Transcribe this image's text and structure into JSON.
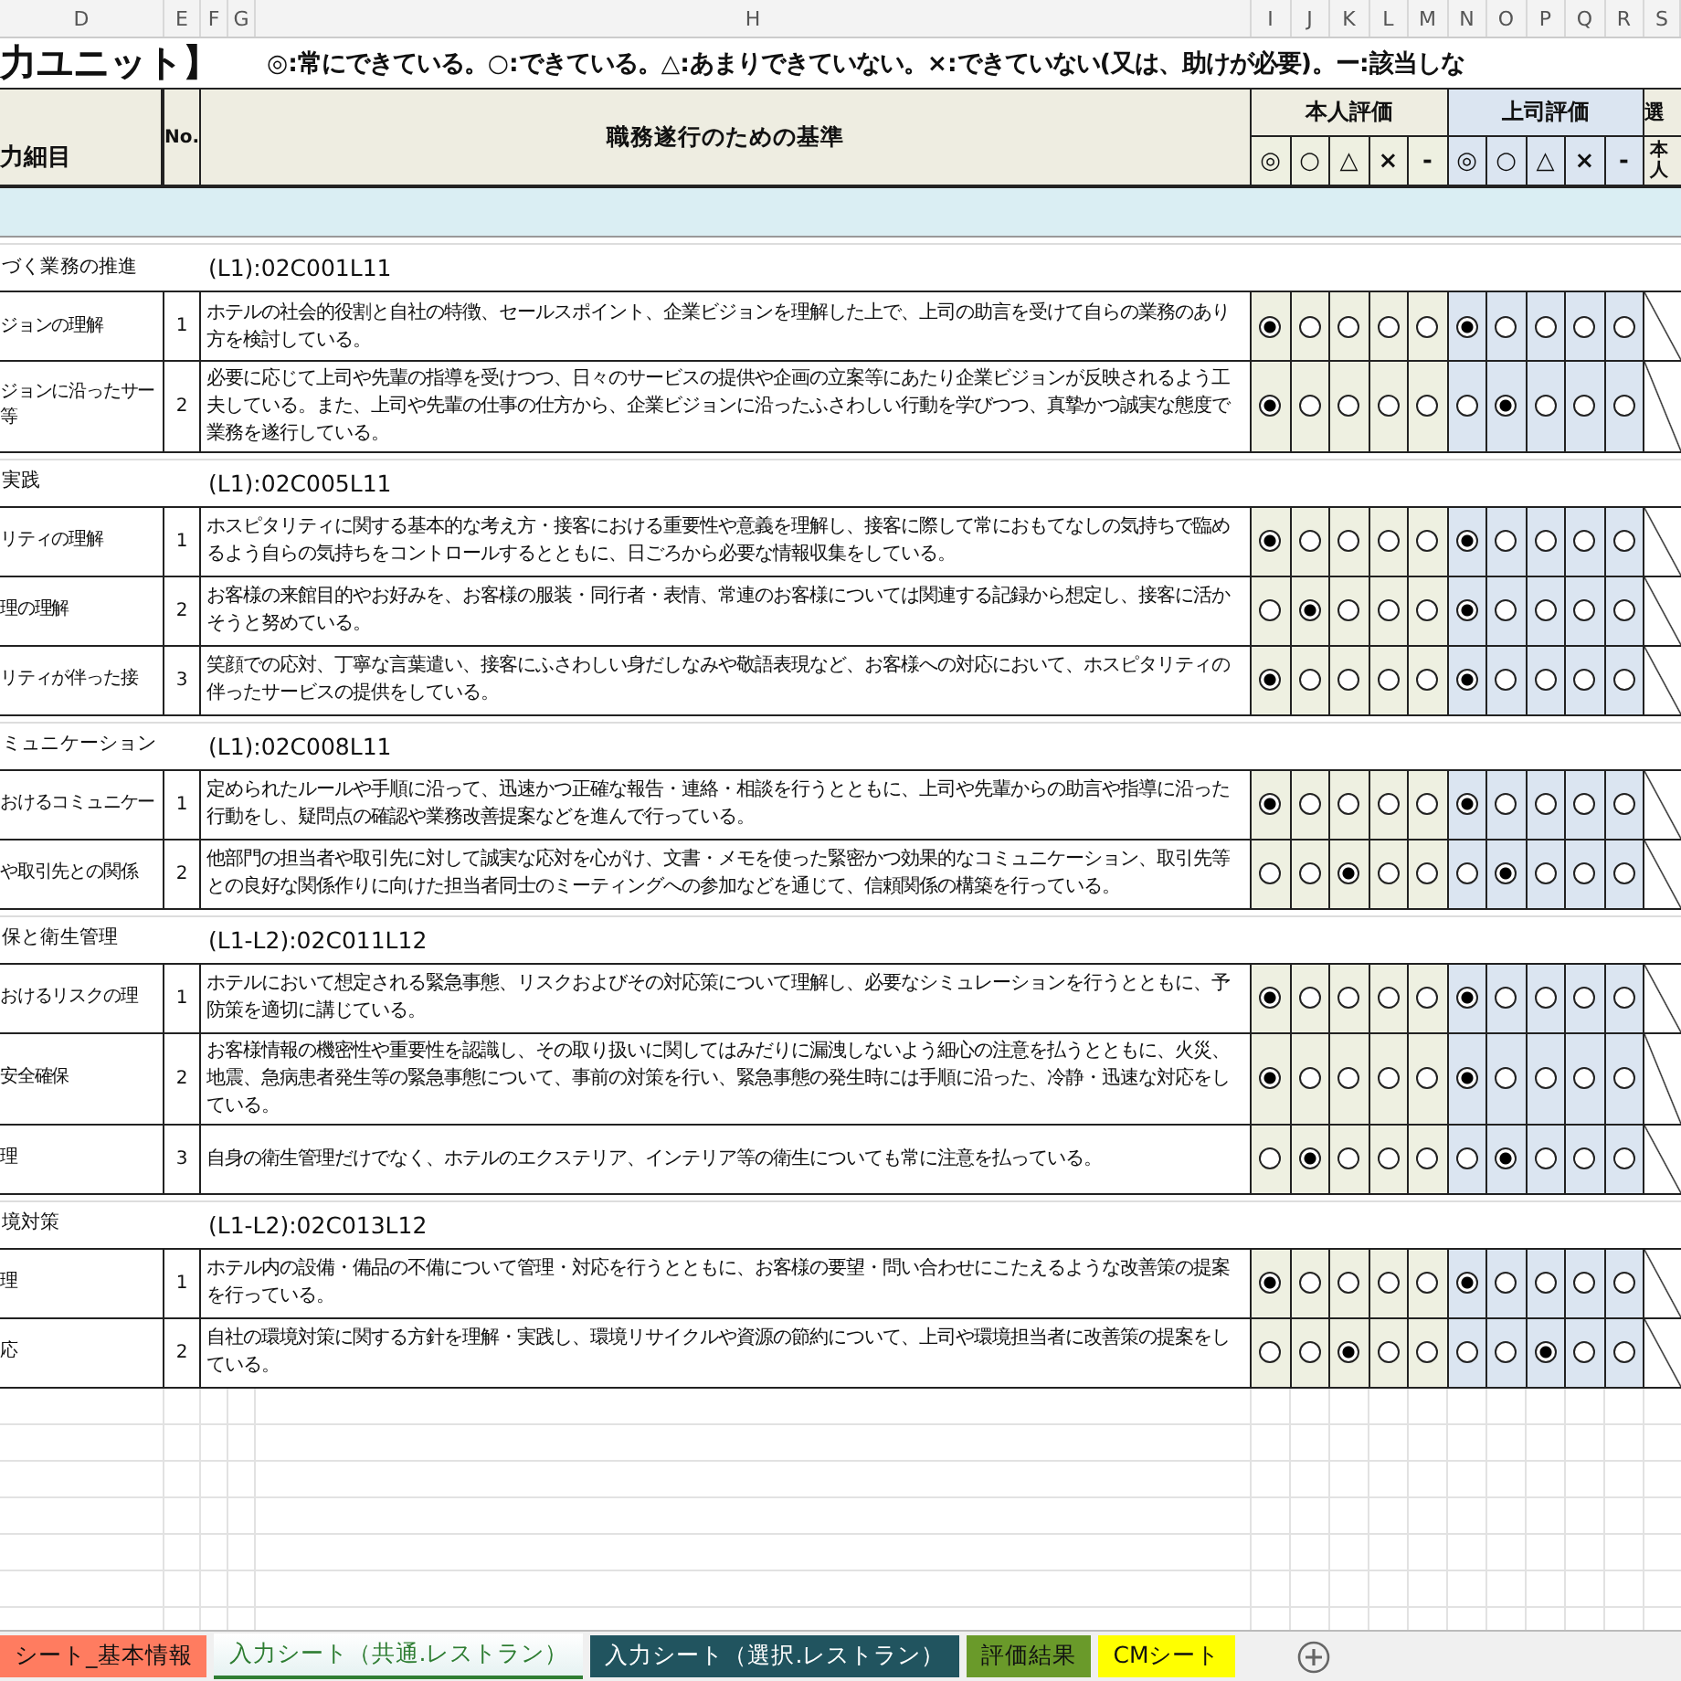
{
  "column_headers": [
    "D",
    "E",
    "F",
    "G",
    "H",
    "I",
    "J",
    "K",
    "L",
    "M",
    "N",
    "O",
    "P",
    "Q",
    "R",
    "S"
  ],
  "title": "力ユニット】",
  "legend": "◎:常にできている。○:できている。△:あまりできていない。×:できていない(又は、助けが必要)。ー:該当しな",
  "table_header": {
    "category": "力細目",
    "number": "No.",
    "criteria": "職務遂行のための基準",
    "self_group": "本人評価",
    "boss_group": "上司評価",
    "select_group": "選",
    "self_options": [
      "◎",
      "○",
      "△",
      "×",
      "-"
    ],
    "boss_options": [
      "◎",
      "○",
      "△",
      "×",
      "-"
    ],
    "select_sub": "本人"
  },
  "sections": [
    {
      "label": "づく業務の推進",
      "code": "(L1):02C001L11",
      "items": [
        {
          "label": "ジョンの理解",
          "no": "1",
          "criteria": "ホテルの社会的役割と自社の特徴、セールスポイント、企業ビジョンを理解した上で、上司の助言を受けて自らの業務のあり方を検討している。",
          "self": [
            {
              "selected": true
            },
            {
              "selected": false
            },
            {
              "selected": false
            },
            {
              "selected": false
            },
            {
              "selected": false
            }
          ],
          "boss": [
            {
              "selected": true
            },
            {
              "selected": false
            },
            {
              "selected": false
            },
            {
              "selected": false
            },
            {
              "selected": false
            }
          ]
        },
        {
          "label": "ジョンに沿ったサー",
          "label_2": "等",
          "no": "2",
          "criteria": "必要に応じて上司や先輩の指導を受けつつ、日々のサービスの提供や企画の立案等にあたり企業ビジョンが反映されるよう工夫している。また、上司や先輩の仕事の仕方から、企業ビジョンに沿ったふさわしい行動を学びつつ、真摯かつ誠実な態度で業務を遂行している。",
          "self": [
            {
              "selected": true
            },
            {
              "selected": false
            },
            {
              "selected": false
            },
            {
              "selected": false
            },
            {
              "selected": false
            }
          ],
          "boss": [
            {
              "selected": false
            },
            {
              "selected": true
            },
            {
              "selected": false
            },
            {
              "selected": false
            },
            {
              "selected": false
            }
          ]
        }
      ]
    },
    {
      "label": "実践",
      "code": "(L1):02C005L11",
      "items": [
        {
          "label": "リティの理解",
          "no": "1",
          "criteria": "ホスピタリティに関する基本的な考え方・接客における重要性や意義を理解し、接客に際して常におもてなしの気持ちで臨めるよう自らの気持ちをコントロールするとともに、日ごろから必要な情報収集をしている。",
          "self": [
            {
              "selected": true
            },
            {
              "selected": false
            },
            {
              "selected": false
            },
            {
              "selected": false
            },
            {
              "selected": false
            }
          ],
          "boss": [
            {
              "selected": true
            },
            {
              "selected": false
            },
            {
              "selected": false
            },
            {
              "selected": false
            },
            {
              "selected": false
            }
          ]
        },
        {
          "label": "理の理解",
          "no": "2",
          "criteria": "お客様の来館目的やお好みを、お客様の服装・同行者・表情、常連のお客様については関連する記録から想定し、接客に活かそうと努めている。",
          "self": [
            {
              "selected": false
            },
            {
              "selected": true
            },
            {
              "selected": false
            },
            {
              "selected": false
            },
            {
              "selected": false
            }
          ],
          "boss": [
            {
              "selected": true
            },
            {
              "selected": false
            },
            {
              "selected": false
            },
            {
              "selected": false
            },
            {
              "selected": false
            }
          ]
        },
        {
          "label": "リティが伴った接",
          "no": "3",
          "criteria": "笑顔での応対、丁寧な言葉遣い、接客にふさわしい身だしなみや敬語表現など、お客様への対応において、ホスピタリティの伴ったサービスの提供をしている。",
          "self": [
            {
              "selected": true
            },
            {
              "selected": false
            },
            {
              "selected": false
            },
            {
              "selected": false
            },
            {
              "selected": false
            }
          ],
          "boss": [
            {
              "selected": true
            },
            {
              "selected": false
            },
            {
              "selected": false
            },
            {
              "selected": false
            },
            {
              "selected": false
            }
          ]
        }
      ]
    },
    {
      "label": "ミュニケーション",
      "code": "(L1):02C008L11",
      "items": [
        {
          "label": "おけるコミュニケー",
          "no": "1",
          "criteria": "定められたルールや手順に沿って、迅速かつ正確な報告・連絡・相談を行うとともに、上司や先輩からの助言や指導に沿った行動をし、疑問点の確認や業務改善提案などを進んで行っている。",
          "self": [
            {
              "selected": true
            },
            {
              "selected": false
            },
            {
              "selected": false
            },
            {
              "selected": false
            },
            {
              "selected": false
            }
          ],
          "boss": [
            {
              "selected": true
            },
            {
              "selected": false
            },
            {
              "selected": false
            },
            {
              "selected": false
            },
            {
              "selected": false
            }
          ]
        },
        {
          "label": "や取引先との関係",
          "no": "2",
          "criteria": "他部門の担当者や取引先に対して誠実な応対を心がけ、文書・メモを使った緊密かつ効果的なコミュニケーション、取引先等との良好な関係作りに向けた担当者同士のミーティングへの参加などを通じて、信頼関係の構築を行っている。",
          "self": [
            {
              "selected": false
            },
            {
              "selected": false
            },
            {
              "selected": true
            },
            {
              "selected": false
            },
            {
              "selected": false
            }
          ],
          "boss": [
            {
              "selected": false
            },
            {
              "selected": true
            },
            {
              "selected": false
            },
            {
              "selected": false
            },
            {
              "selected": false
            }
          ]
        }
      ]
    },
    {
      "label": "保と衛生管理",
      "code": "(L1-L2):02C011L12",
      "items": [
        {
          "label": "おけるリスクの理",
          "no": "1",
          "criteria": "ホテルにおいて想定される緊急事態、リスクおよびその対応策について理解し、必要なシミュレーションを行うとともに、予防策を適切に講じている。",
          "self": [
            {
              "selected": true
            },
            {
              "selected": false
            },
            {
              "selected": false
            },
            {
              "selected": false
            },
            {
              "selected": false
            }
          ],
          "boss": [
            {
              "selected": true
            },
            {
              "selected": false
            },
            {
              "selected": false
            },
            {
              "selected": false
            },
            {
              "selected": false
            }
          ]
        },
        {
          "label": "安全確保",
          "no": "2",
          "criteria": "お客様情報の機密性や重要性を認識し、その取り扱いに関してはみだりに漏洩しないよう細心の注意を払うとともに、火災、地震、急病患者発生等の緊急事態について、事前の対策を行い、緊急事態の発生時には手順に沿った、冷静・迅速な対応をしている。",
          "self": [
            {
              "selected": true
            },
            {
              "selected": false
            },
            {
              "selected": false
            },
            {
              "selected": false
            },
            {
              "selected": false
            }
          ],
          "boss": [
            {
              "selected": true
            },
            {
              "selected": false
            },
            {
              "selected": false
            },
            {
              "selected": false
            },
            {
              "selected": false
            }
          ]
        },
        {
          "label": "理",
          "no": "3",
          "criteria": "自身の衛生管理だけでなく、ホテルのエクステリア、インテリア等の衛生についても常に注意を払っている。",
          "self": [
            {
              "selected": false
            },
            {
              "selected": true
            },
            {
              "selected": false
            },
            {
              "selected": false
            },
            {
              "selected": false
            }
          ],
          "boss": [
            {
              "selected": false
            },
            {
              "selected": true
            },
            {
              "selected": false
            },
            {
              "selected": false
            },
            {
              "selected": false
            }
          ]
        }
      ]
    },
    {
      "label": "境対策",
      "code": "(L1-L2):02C013L12",
      "items": [
        {
          "label": "理",
          "no": "1",
          "criteria": "ホテル内の設備・備品の不備について管理・対応を行うとともに、お客様の要望・問い合わせにこたえるような改善策の提案を行っている。",
          "self": [
            {
              "selected": true
            },
            {
              "selected": false
            },
            {
              "selected": false
            },
            {
              "selected": false
            },
            {
              "selected": false
            }
          ],
          "boss": [
            {
              "selected": true
            },
            {
              "selected": false
            },
            {
              "selected": false
            },
            {
              "selected": false
            },
            {
              "selected": false
            }
          ]
        },
        {
          "label": "応",
          "no": "2",
          "criteria": "自社の環境対策に関する方針を理解・実践し、環境リサイクルや資源の節約について、上司や環境担当者に改善策の提案をしている。",
          "self": [
            {
              "selected": false
            },
            {
              "selected": false
            },
            {
              "selected": true
            },
            {
              "selected": false
            },
            {
              "selected": false
            }
          ],
          "boss": [
            {
              "selected": false
            },
            {
              "selected": false
            },
            {
              "selected": true
            },
            {
              "selected": false
            },
            {
              "selected": false
            }
          ]
        }
      ]
    }
  ],
  "sheet_tabs": [
    {
      "label": "シート_基本情報",
      "color": "#ff7c60",
      "selected": false
    },
    {
      "label": "入力シート（共通.レストラン）",
      "color": "#2e7d32",
      "selected": true
    },
    {
      "label": "入力シート（選択.レストラン）",
      "color": "#21545f",
      "selected": false
    },
    {
      "label": "評価結果",
      "color": "#6a9a2a",
      "selected": false
    },
    {
      "label": "CMシート",
      "color": "#ffff00",
      "selected": false
    }
  ]
}
